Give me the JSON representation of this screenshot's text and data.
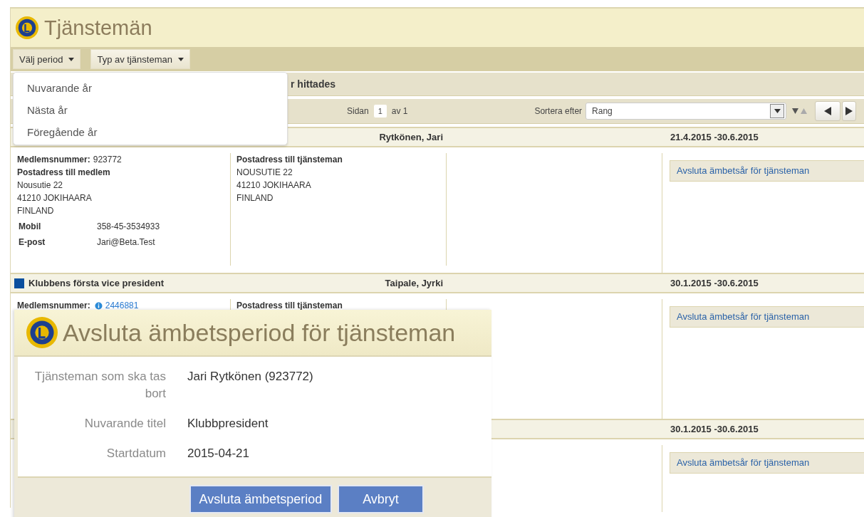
{
  "page": {
    "title": "Tjänstemän"
  },
  "toolbar": {
    "menus": [
      {
        "label": "Välj period",
        "expanded": true,
        "items": [
          "Nuvarande år",
          "Nästa år",
          "Föregående år"
        ]
      },
      {
        "label": "Typ av tjänsteman",
        "expanded": false
      }
    ]
  },
  "results": {
    "summary": "r hittades"
  },
  "pager": {
    "page_label": "Sidan",
    "page": "1",
    "of": "av 1",
    "sort_label": "Sortera efter",
    "sort_value": "Rang"
  },
  "records": [
    {
      "name": "Rytkönen, Jari",
      "period": "21.4.2015 -30.6.2015",
      "member": {
        "number_label": "Medlemsnummer:",
        "number": "923772",
        "number_link": false,
        "address_label": "Postadress till medlem",
        "address": [
          "Nousutie 22",
          "41210 JOKIHAARA",
          "FINLAND"
        ],
        "contacts": [
          {
            "label": "Mobil",
            "value": "358-45-3534933"
          },
          {
            "label": "E-post",
            "value": "Jari@Beta.Test"
          }
        ]
      },
      "official": {
        "address_label": "Postadress till tjänsteman",
        "address": [
          "NOUSUTIE 22",
          "41210 JOKIHAARA",
          "FINLAND"
        ]
      },
      "action": "Avsluta ämbetsår för tjänsteman"
    },
    {
      "title": "Klubbens första vice president",
      "color": "#0b4f9e",
      "name": "Taipale, Jyrki",
      "period": "30.1.2015 -30.6.2015",
      "member": {
        "number_label": "Medlemsnummer:",
        "number": "2446881",
        "number_link": true
      },
      "official": {
        "address_label": "Postadress till tjänsteman"
      },
      "action": "Avsluta ämbetsår för tjänsteman"
    },
    {
      "period": "30.1.2015 -30.6.2015",
      "action": "Avsluta ämbetsår för tjänsteman"
    }
  ],
  "dialog": {
    "title": "Avsluta ämbetsperiod för tjänsteman",
    "fields": [
      {
        "label": "Tjänsteman som ska tas bort",
        "value": "Jari Rytkönen (923772)"
      },
      {
        "label": "Nuvarande titel",
        "value": "Klubbpresident"
      },
      {
        "label": "Startdatum",
        "value": "2015-04-21"
      }
    ],
    "buttons": [
      "Avsluta ämbetsperiod",
      "Avbryt"
    ]
  }
}
